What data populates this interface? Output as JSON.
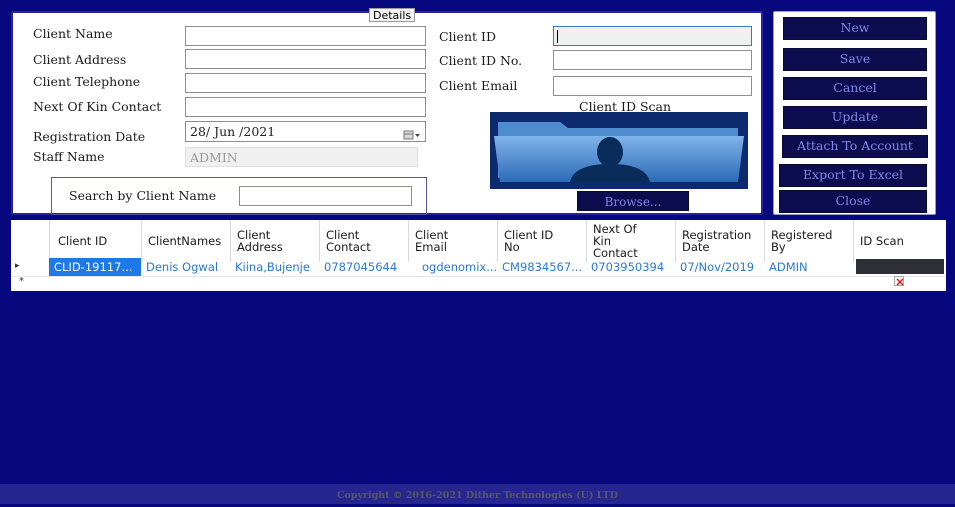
{
  "details": {
    "legend": "Details",
    "client_name_label": "Client Name",
    "client_address_label": "Client Address",
    "client_telephone_label": "Client Telephone",
    "next_of_kin_label": "Next Of Kin Contact",
    "registration_date_label": "Registration Date",
    "registration_date_value": "28/ Jun /2021",
    "staff_name_label": "Staff Name",
    "staff_name_value": "ADMIN",
    "client_id_label": "Client ID",
    "client_id_no_label": "Client ID No.",
    "client_email_label": "Client Email",
    "client_id_scan_label": "Client ID Scan",
    "browse_label": "Browse..."
  },
  "search": {
    "label": "Search by Client Name",
    "value": ""
  },
  "actions": {
    "new": "New",
    "save": "Save",
    "cancel": "Cancel",
    "update": "Update",
    "attach": "Attach To Account",
    "export": "Export To Excel",
    "close": "Close"
  },
  "table": {
    "headers": {
      "client_id": "Client ID",
      "client_names": "ClientNames",
      "client_address": "Client Address",
      "client_contact": "Client Contact",
      "client_email": "Client Email",
      "client_id_no": "Client ID No",
      "next_of_kin": "Next Of Kin Contact",
      "registration_date": "Registration Date",
      "registered_by": "Registered By",
      "id_scan": "ID Scan"
    },
    "rows": [
      {
        "client_id": "CLID-19117...",
        "client_names": "Denis Ogwal",
        "client_address": "Kiina,Bujenje",
        "client_contact": "0787045644",
        "client_email": "ogdenomix...",
        "client_id_no": "CM9834567...",
        "next_of_kin": "0703950394",
        "registration_date": "07/Nov/2019",
        "registered_by": "ADMIN"
      }
    ],
    "new_row_marker": "*",
    "current_row_marker": "▸"
  },
  "footer": {
    "copyright": "Copyright © 2016-2021 Dither Technologies (U) LTD"
  },
  "colors": {
    "background": "#08087e",
    "button_bg": "#0c0c4e",
    "button_text": "#7f86e8",
    "link_text": "#2a7ad8",
    "selected_cell": "#1e78e6"
  }
}
